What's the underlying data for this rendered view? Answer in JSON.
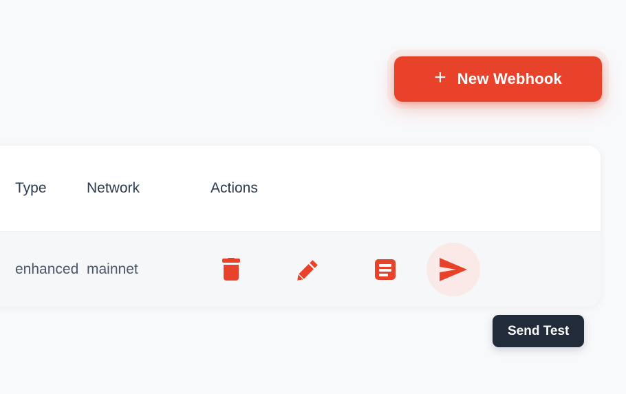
{
  "page": {
    "background_color": "#f8f9fb",
    "accent_color": "#e8432a"
  },
  "toolbar": {
    "new_webhook_label": "New Webhook",
    "new_webhook_icon": "plus-icon",
    "plus_glyph": "+"
  },
  "table": {
    "columns": [
      "Type",
      "Network",
      "Actions"
    ],
    "rows": [
      {
        "type": "enhanced",
        "network": "mainnet",
        "actions": [
          {
            "name": "delete-webhook-button",
            "icon": "trash-icon",
            "color": "#e8432a"
          },
          {
            "name": "edit-webhook-button",
            "icon": "pencil-icon",
            "color": "#e8432a"
          },
          {
            "name": "view-logs-button",
            "icon": "logs-icon",
            "color": "#e8432a"
          },
          {
            "name": "send-test-button",
            "icon": "send-icon",
            "color": "#e8432a",
            "background": "#fae9e6"
          }
        ]
      }
    ]
  },
  "tooltip": {
    "text": "Send Test",
    "background_color": "#212b3a",
    "text_color": "#ffffff"
  }
}
